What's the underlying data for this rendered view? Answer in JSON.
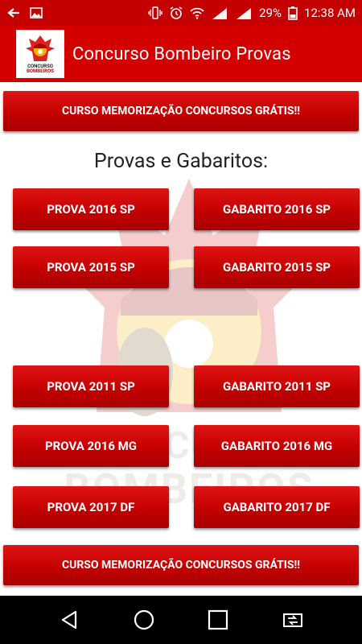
{
  "status_bar": {
    "battery_percent": "29%",
    "time": "12:38 AM",
    "network_1": "3G",
    "network_2": "2G"
  },
  "app_bar": {
    "title": "Concurso Bombeiro Provas",
    "logo_text_top": "CONCURSO",
    "logo_text_bottom": "BOMBEIROS"
  },
  "promo": {
    "top_label": "CURSO MEMORIZAÇÃO CONCURSOS GRÁTIS!!",
    "bottom_label": "CURSO MEMORIZAÇÃO CONCURSOS GRÁTIS!!"
  },
  "section": {
    "title": "Provas e Gabaritos:"
  },
  "rows": [
    {
      "prova": "PROVA 2016 SP",
      "gabarito": "GABARITO 2016 SP"
    },
    {
      "prova": "PROVA 2015 SP",
      "gabarito": "GABARITO 2015 SP"
    },
    {
      "prova": "PROVA 2011 SP",
      "gabarito": "GABARITO 2011 SP"
    },
    {
      "prova": "PROVA 2016 MG",
      "gabarito": "GABARITO 2016 MG"
    },
    {
      "prova": "PROVA 2017 DF",
      "gabarito": "GABARITO 2017 DF"
    }
  ],
  "watermark": {
    "line1": "CONCURSO",
    "line2": "BOMBEIROS"
  },
  "colors": {
    "status_bar": "#c40000",
    "app_bar": "#d40000",
    "button": "#c40000",
    "nav_bar": "#000000"
  }
}
